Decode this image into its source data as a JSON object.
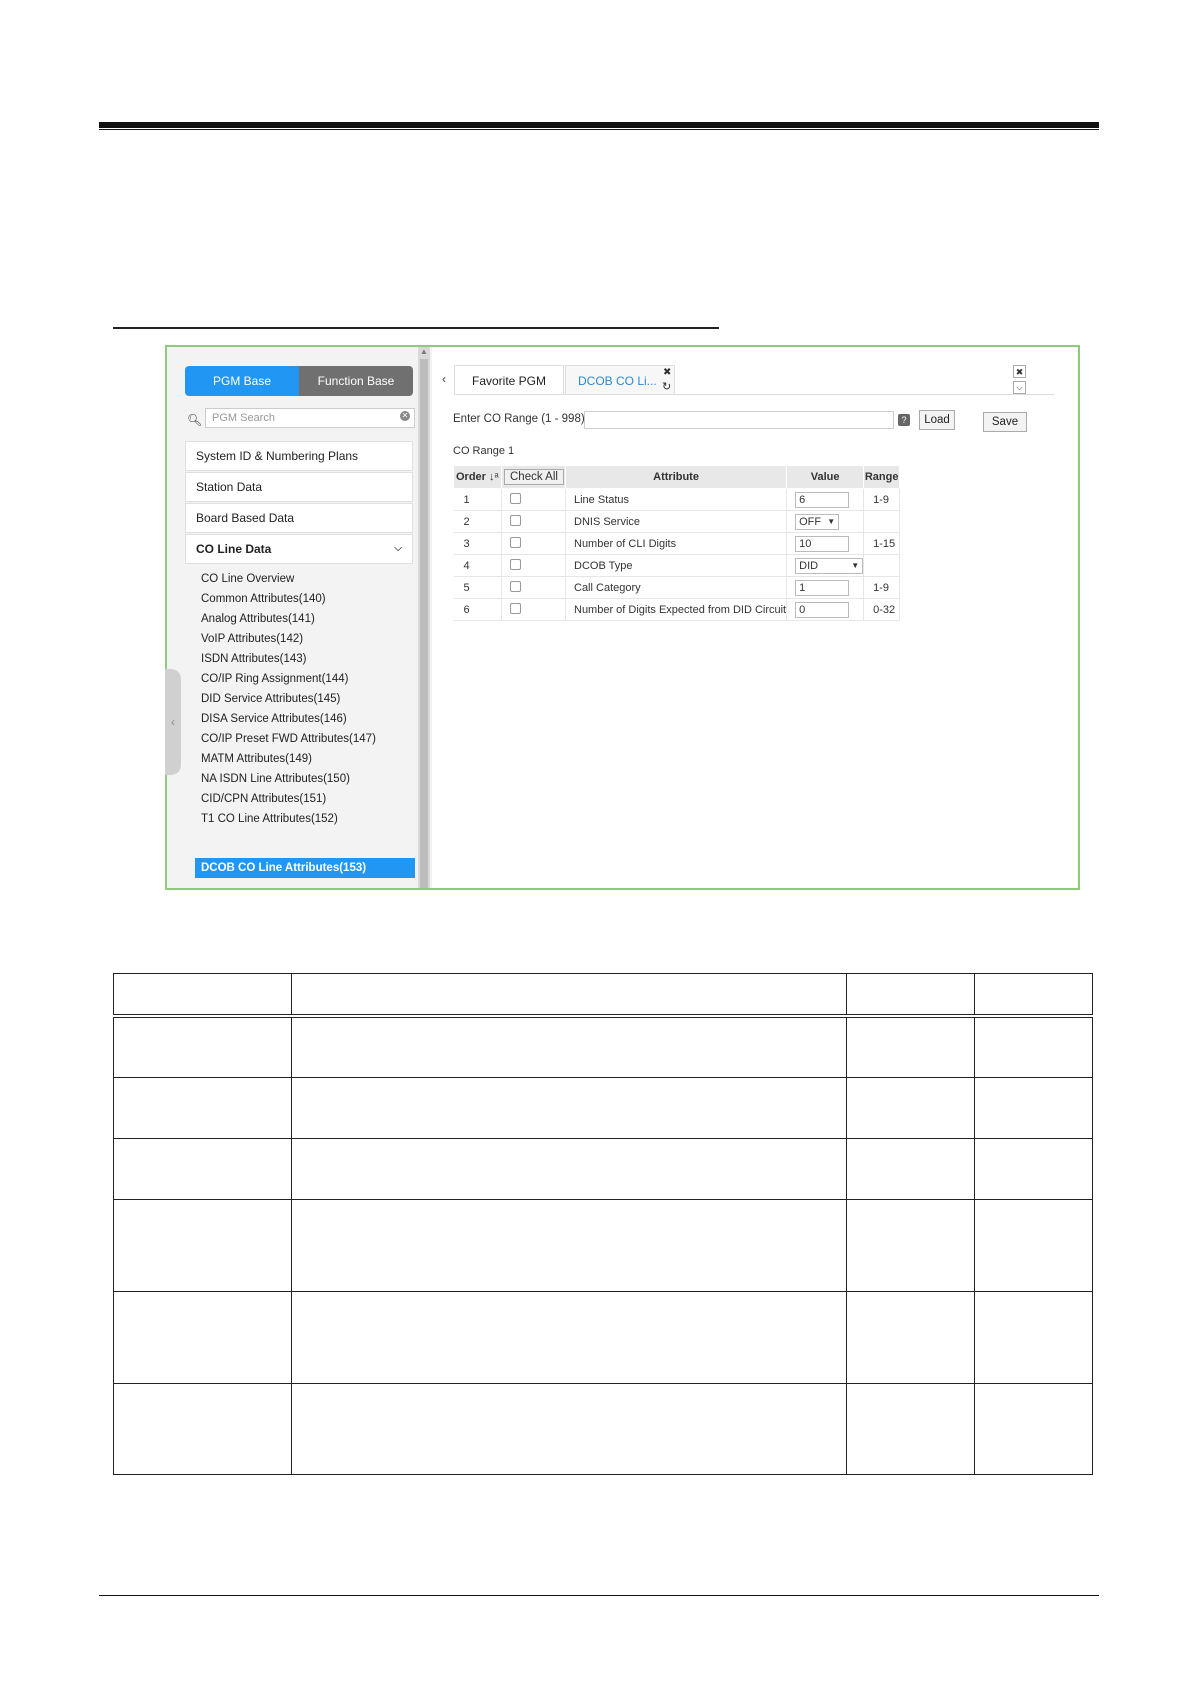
{
  "sidebar": {
    "pgm_base": "PGM Base",
    "function_base": "Function Base",
    "search_placeholder": "PGM Search",
    "categories": [
      "System ID & Numbering Plans",
      "Station Data",
      "Board Based Data",
      "CO Line Data"
    ],
    "sub_items": [
      "CO Line Overview",
      "Common Attributes(140)",
      "Analog Attributes(141)",
      "VoIP Attributes(142)",
      "ISDN Attributes(143)",
      "CO/IP Ring Assignment(144)",
      "DID Service Attributes(145)",
      "DISA Service Attributes(146)",
      "CO/IP Preset FWD Attributes(147)",
      "MATM Attributes(149)",
      "NA ISDN Line Attributes(150)",
      "CID/CPN Attributes(151)",
      "T1 CO Line Attributes(152)",
      "DCOB CO Line Attributes(153)"
    ]
  },
  "tabs": {
    "favorite": "Favorite PGM",
    "active": "DCOB CO Li..."
  },
  "form": {
    "range_label": "Enter CO Range (1 - 998) :",
    "load": "Load",
    "save": "Save",
    "range_title": "CO Range 1"
  },
  "table": {
    "headers": [
      "Order",
      "Check All",
      "Attribute",
      "Value",
      "Range"
    ],
    "rows": [
      {
        "order": "1",
        "attribute": "Line Status",
        "value": "6",
        "range": "1-9",
        "kind": "input"
      },
      {
        "order": "2",
        "attribute": "DNIS Service",
        "value": "OFF",
        "range": "",
        "kind": "select"
      },
      {
        "order": "3",
        "attribute": "Number of CLI Digits",
        "value": "10",
        "range": "1-15",
        "kind": "input"
      },
      {
        "order": "4",
        "attribute": "DCOB Type",
        "value": "DID",
        "range": "",
        "kind": "select"
      },
      {
        "order": "5",
        "attribute": "Call Category",
        "value": "1",
        "range": "1-9",
        "kind": "input"
      },
      {
        "order": "6",
        "attribute": "Number of Digits Expected from DID Circuit",
        "value": "0",
        "range": "0-32",
        "kind": "input"
      }
    ]
  },
  "colors": {
    "frame_border": "#8fc97a",
    "accent": "#2196f3"
  }
}
